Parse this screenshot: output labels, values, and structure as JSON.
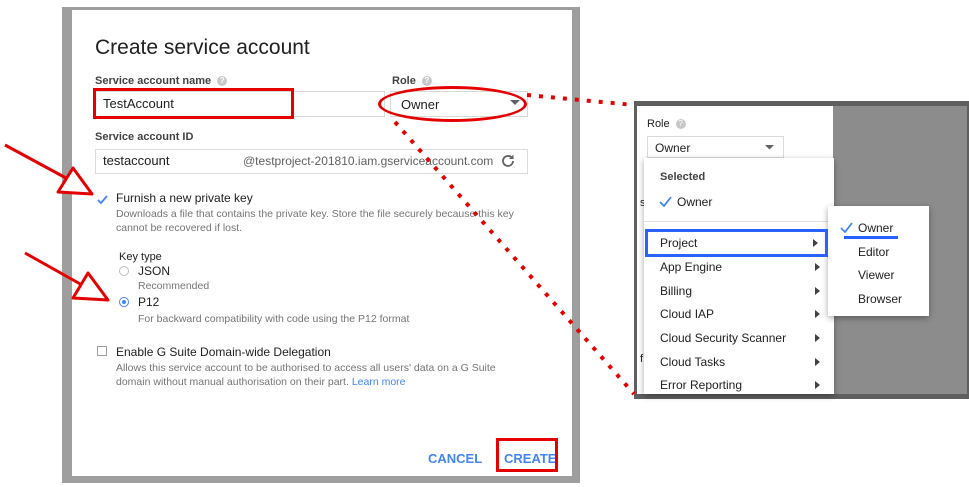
{
  "dialog": {
    "title": "Create service account",
    "name_label": "Service account name",
    "name_value": "TestAccount",
    "role_label": "Role",
    "role_value": "Owner",
    "id_label": "Service account ID",
    "id_value": "testaccount",
    "id_suffix": "@testproject-201810.iam.gserviceaccount.com",
    "furnish_label": "Furnish a new private key",
    "furnish_desc_1": "Downloads a file that contains the private key. Store the file securely because this key",
    "furnish_desc_2": "cannot be recovered if lost.",
    "key_type_label": "Key type",
    "json_label": "JSON",
    "json_note": "Recommended",
    "p12_label": "P12",
    "p12_note": "For backward compatibility with code using the P12 format",
    "delegation_label": "Enable G Suite Domain-wide Delegation",
    "delegation_desc_1": "Allows this service account to be authorised to access all users' data on a G Suite",
    "delegation_desc_2": "domain without manual authorisation on their part.",
    "learn_more": "Learn more",
    "cancel": "CANCEL",
    "create": "CREATE",
    "help_glyph": "?",
    "furnish_checked": true,
    "selected_key_type": "P12",
    "delegation_checked": false
  },
  "role_panel": {
    "role_label": "Role",
    "role_value": "Owner",
    "selected_header": "Selected",
    "selected_item": "Owner",
    "categories": [
      "Project",
      "App Engine",
      "Billing",
      "Cloud IAP",
      "Cloud Security Scanner",
      "Cloud Tasks",
      "Error Reporting"
    ],
    "submenu": [
      "Owner",
      "Editor",
      "Viewer",
      "Browser"
    ],
    "partial_glyphs": [
      "s",
      "f"
    ]
  },
  "colors": {
    "accent": "#4285f4",
    "annotation_red": "#e50000",
    "annotation_blue": "#2962ff"
  },
  "icons": {
    "refresh": "refresh-icon",
    "dropdown": "caret-down-icon",
    "submenu_arrow": "chevron-right-icon",
    "check": "check-icon"
  }
}
